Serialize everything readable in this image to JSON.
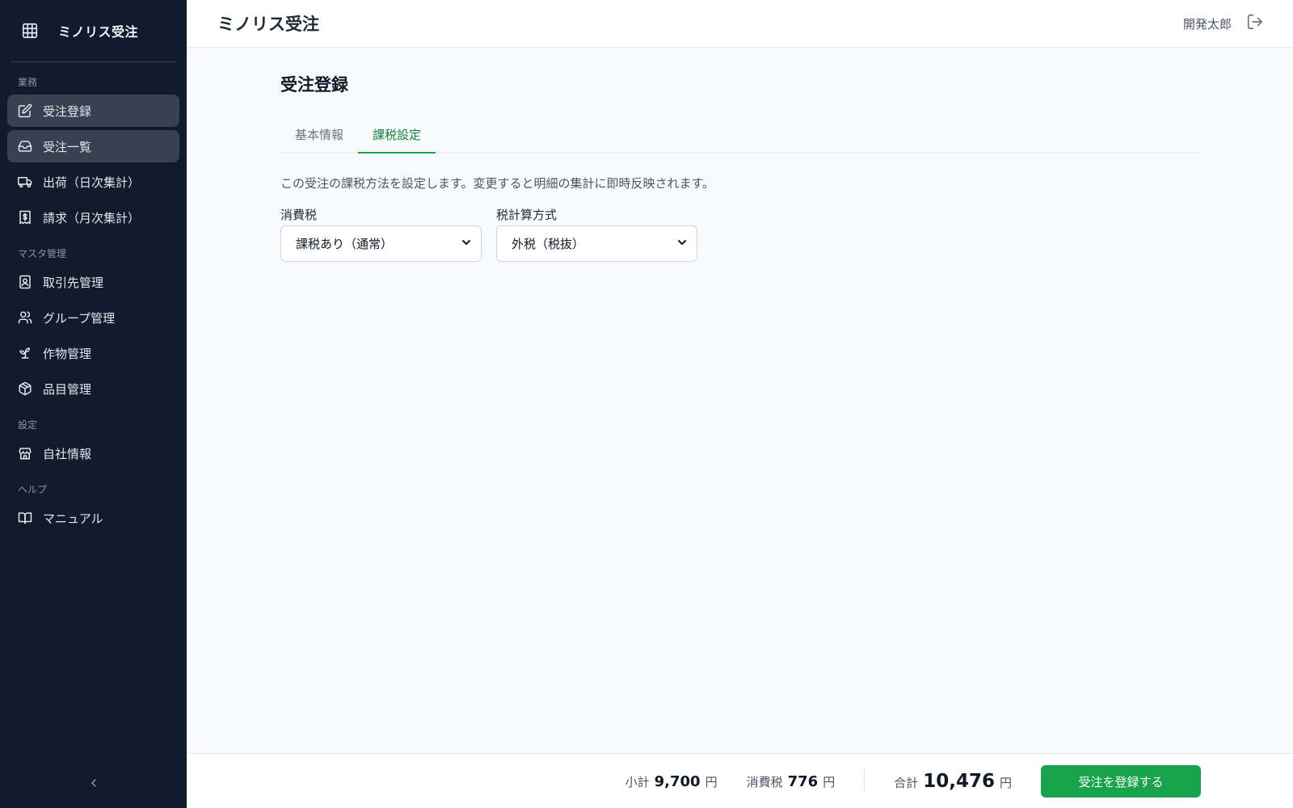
{
  "sidebar": {
    "brand": "ミノリス受注",
    "sections": [
      {
        "label": "業務"
      },
      {
        "label": "マスタ管理"
      },
      {
        "label": "設定"
      },
      {
        "label": "ヘルプ"
      }
    ],
    "items": [
      {
        "label": "受注登録",
        "icon": "edit-icon"
      },
      {
        "label": "受注一覧",
        "icon": "inbox-icon"
      },
      {
        "label": "出荷（日次集計）",
        "icon": "truck-icon"
      },
      {
        "label": "請求（月次集計）",
        "icon": "invoice-icon"
      },
      {
        "label": "取引先管理",
        "icon": "contact-icon"
      },
      {
        "label": "グループ管理",
        "icon": "users-icon"
      },
      {
        "label": "作物管理",
        "icon": "sprout-icon"
      },
      {
        "label": "品目管理",
        "icon": "package-icon"
      },
      {
        "label": "自社情報",
        "icon": "store-icon"
      },
      {
        "label": "マニュアル",
        "icon": "book-icon"
      }
    ]
  },
  "header": {
    "title": "ミノリス受注",
    "user_name": "開発太郎"
  },
  "main": {
    "page_title": "受注登録",
    "tabs": [
      {
        "label": "基本情報"
      },
      {
        "label": "課税設定"
      }
    ],
    "description": "この受注の課税方法を設定します。変更すると明細の集計に即時反映されます。",
    "fields": [
      {
        "label": "消費税",
        "value": "課税あり（通常）"
      },
      {
        "label": "税計算方式",
        "value": "外税（税抜）"
      }
    ]
  },
  "footer": {
    "subtotal_label": "小計",
    "subtotal_value": "9,700",
    "tax_label": "消費税",
    "tax_value": "776",
    "total_label": "合計",
    "total_value": "10,476",
    "currency": "円",
    "submit_label": "受注を登録する"
  },
  "colors": {
    "sidebar_bg": "#111b2e",
    "accent": "#16a34a",
    "active_item_bg": "#374151"
  }
}
